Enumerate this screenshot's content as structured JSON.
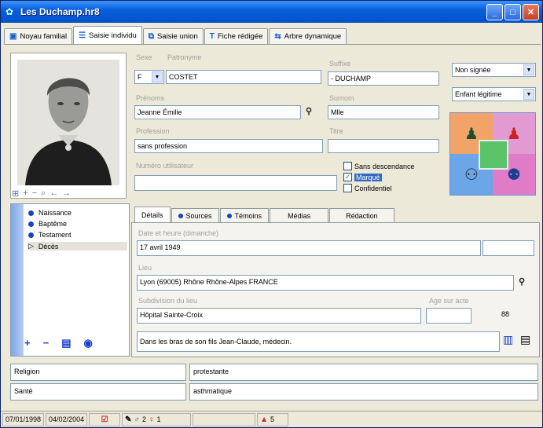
{
  "window": {
    "title": "Les Duchamp.hr8"
  },
  "tabs": [
    {
      "label": "Noyau familial",
      "icon": "family-icon"
    },
    {
      "label": "Saisie individu",
      "icon": "list-icon"
    },
    {
      "label": "Saisie union",
      "icon": "union-icon"
    },
    {
      "label": "Fiche rédigée",
      "icon": "text-icon"
    },
    {
      "label": "Arbre dynamique",
      "icon": "tree-icon"
    }
  ],
  "form": {
    "sexe": {
      "label": "Sexe",
      "value": "F"
    },
    "patronyme": {
      "label": "Patronyme",
      "value": "COSTET"
    },
    "suffixe": {
      "label": "Suffixe",
      "value": "- DUCHAMP"
    },
    "prenoms": {
      "label": "Prénoms",
      "value": "Jeanne Émilie"
    },
    "surnom": {
      "label": "Surnom",
      "value": "Mlle"
    },
    "profession": {
      "label": "Profession",
      "value": "sans profession"
    },
    "titre": {
      "label": "Titre",
      "value": ""
    },
    "numero": {
      "label": "Numéro utilisateur",
      "value": ""
    },
    "checks": [
      {
        "label": "Sans descendance",
        "checked": false
      },
      {
        "label": "Marqué",
        "checked": true
      },
      {
        "label": "Confidentiel",
        "checked": false
      }
    ],
    "filiation": {
      "value": "Non signée"
    },
    "enfant": {
      "value": "Enfant légitime"
    }
  },
  "events": [
    "Naissance",
    "Baptême",
    "Testament",
    "Décès"
  ],
  "subtabs": [
    "Détails",
    "Sources",
    "Témoins",
    "Médias",
    "Rédaction"
  ],
  "detail": {
    "date_label": "Date et heure (dimanche)",
    "date_value": "17 avril 1949",
    "lieu_label": "Lieu",
    "lieu_value": "Lyon (69005) Rhône Rhône-Alpes FRANCE",
    "subdiv_label": "Subdivision du lieu",
    "subdiv_value": "Hôpital Sainte-Croix",
    "age_label": "Age sur acte",
    "age_value": "88",
    "note": "Dans les bras de son fils Jean-Claude, médecin."
  },
  "attributes": [
    {
      "key": "Religion",
      "value": "protestante"
    },
    {
      "key": "Santé",
      "value": "asthmatique"
    }
  ],
  "status": {
    "date_created": "07/01/1998",
    "date_modified": "04/02/2004",
    "males": "2",
    "females": "1",
    "count": "5"
  },
  "colors": {
    "titlebar": "#0051C8",
    "accent": "#1840C8",
    "tile_green": "#5BC46A"
  }
}
